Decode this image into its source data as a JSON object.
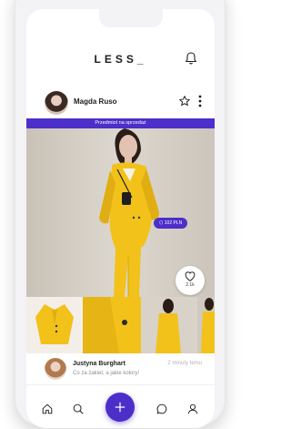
{
  "app": {
    "logo": "LESS_"
  },
  "post": {
    "author": "Magda Ruso",
    "banner": "Przedmiot na sprzedaż",
    "price_tag": "102 PLN",
    "likes": "2.1k"
  },
  "comment": {
    "author": "Justyna Burghart",
    "time": "2 minuty temu",
    "text": "Co za żakiet, a jakie kolory!"
  },
  "nav": {
    "items": [
      "home-icon",
      "search-icon",
      "add-icon",
      "chat-icon",
      "profile-icon"
    ]
  },
  "colors": {
    "accent": "#4c2ec9",
    "garment": "#f2c21b"
  }
}
